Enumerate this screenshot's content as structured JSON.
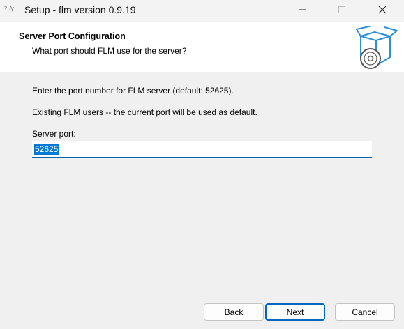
{
  "window": {
    "title": "Setup - flm version 0.9.19",
    "icons": {
      "app": "setup-app-icon",
      "minimize": "minimize-icon",
      "maximize": "maximize-icon",
      "close": "close-icon"
    }
  },
  "header": {
    "title": "Server Port Configuration",
    "subtitle": "What port should FLM use for the server?",
    "image": "installer-box-disc-icon"
  },
  "main": {
    "line1": "Enter the port number for FLM server (default: 52625).",
    "line2": "Existing FLM users -- the current port will be used as default.",
    "port_label": "Server port:",
    "port_value": "52625"
  },
  "buttons": {
    "back": "Back",
    "next": "Next",
    "cancel": "Cancel"
  },
  "colors": {
    "accent": "#0067c0",
    "selection": "#0078d7",
    "header_bg": "#ffffff",
    "dialog_bg": "#f0f0f0"
  }
}
